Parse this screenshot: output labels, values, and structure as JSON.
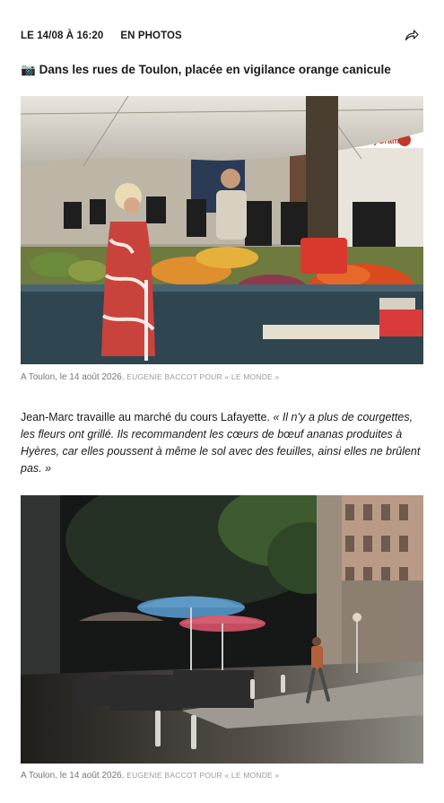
{
  "meta": {
    "timestamp": "LE 14/08 À 16:20",
    "section": "EN PHOTOS",
    "share_icon": "share-arrow-icon"
  },
  "headline": {
    "emoji": "📷",
    "text": "Dans les rues de Toulon, placée en vigilance orange canicule"
  },
  "photos": [
    {
      "caption_place_date": "A Toulon, le 14 août 2026.",
      "caption_credit": "EUGENIE BACCOT POUR « LE MONDE »"
    },
    {
      "caption_place_date": "A Toulon, le 14 août 2026.",
      "caption_credit": "EUGENIE BACCOT POUR « LE MONDE »"
    }
  ],
  "paragraph": {
    "intro": "Jean-Marc travaille au marché du cours Lafayette. ",
    "quote": "« Il n’y a plus de courgettes, les fleurs ont grillé. Ils recommandent les cœurs de bœuf ananas produites à Hyères, car elles poussent à même le sol avec des feuilles, ainsi elles ne brûlent pas. »"
  },
  "colors": {
    "text": "#1a1a1a",
    "caption": "#777777",
    "credit": "#9a9a9a"
  }
}
